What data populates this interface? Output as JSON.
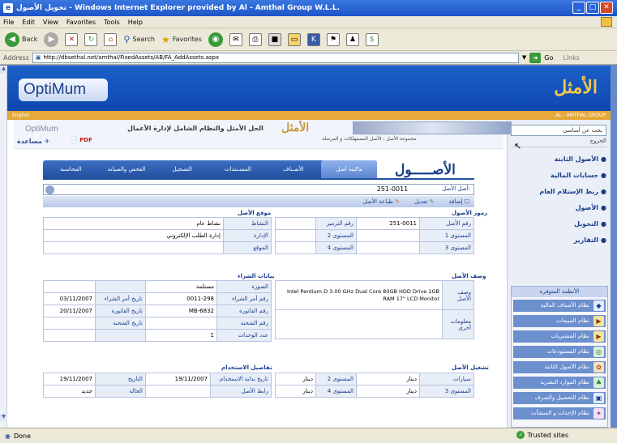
{
  "window": {
    "title": "تحويل الأصول - Windows Internet Explorer provided by Al - Amthal Group W.L.L."
  },
  "menu": [
    "File",
    "Edit",
    "View",
    "Favorites",
    "Tools",
    "Help"
  ],
  "toolbar": {
    "back": "Back",
    "search": "Search",
    "favorites": "Favorites"
  },
  "address": {
    "label": "Address",
    "url": "http://dbsethal.net/amthal/FixedAssets/AB/FA_AddAssets.aspx",
    "go": "Go",
    "links": "Links"
  },
  "banner": {
    "logo": "OptiMum",
    "logo_ar": "الأمثل",
    "english": "English",
    "company": "AL - AMTHAL GROUP"
  },
  "header": {
    "logo": "OptiMum",
    "title": "الحل الأمثل والنظام الشامل لإدارة الأعمال",
    "logo_ar": "الأمثل",
    "breadcrumb": "مجموعة الأصل : الأصل المستهلكات و المرسلة",
    "help": "مساعدة",
    "pdf": "PDF"
  },
  "rightnav": {
    "search": "بحث عن أساسي",
    "header": "الخروج",
    "items": [
      "الأصول الثابتة",
      "حسابات المالية",
      "ربط الإستلام العام",
      "الأصول",
      "التحويل",
      "التقارير"
    ],
    "systems_title": "الأنظمة المتوفرة",
    "systems": [
      "نظام الأصناف المالية",
      "نظام المبيعات",
      "نظام المشتريات",
      "نظام المستودعات",
      "نظام الأصول الثابتة",
      "نظام الموارد البشرية",
      "نظام التحصيل والصرف",
      "نظام الإحداث و المنشآت"
    ]
  },
  "section": {
    "title": "الأصـــــول"
  },
  "tabs": [
    "ماكينة أصل",
    "الأصـناف",
    "المسـتندات",
    "التسجيل",
    "الفحص والصيانة",
    "المحاسبة"
  ],
  "asset": {
    "label": "أصل الأصل:",
    "value": "251-0011"
  },
  "actions": [
    "إضافة",
    "تعديل",
    "طباعة الأصل"
  ],
  "codes": {
    "head": "رموز الأصول",
    "rows": [
      [
        "رقم الأصل",
        "251-0011",
        "رقم الترميز",
        ""
      ],
      [
        "المستوى 1",
        "",
        "المستوى 2",
        ""
      ],
      [
        "المستوى 3",
        "",
        "المستوى 4",
        ""
      ]
    ]
  },
  "location": {
    "head": "موقع الأصل",
    "rows": [
      [
        "النشاط",
        "نشاط عام"
      ],
      [
        "الإدارة",
        "إدارة الطلب الإلكتروني"
      ],
      [
        "الموقع",
        ""
      ]
    ]
  },
  "description": {
    "head": "وصف الأصل",
    "label": "وصف الأصل",
    "text": "Intel Pentium D 3.00 GHz Dual Core 80GB HDD Drive 1GB RAM 17\" LCD Monitor",
    "extra_label": "معلومات أخرى"
  },
  "invoice": {
    "head": "بيانات الشراء",
    "rows": [
      [
        "الصورة",
        "مستلمة",
        "",
        ""
      ],
      [
        "رقم أمر الشراء",
        "0011-298",
        "تاريخ أمر الشراء",
        "03/11/2007"
      ],
      [
        "رقم الفاتورة",
        "MB-6832",
        "تاريخ الفاتورة",
        "20/11/2007"
      ],
      [
        "رقم الشحنة",
        "",
        "تاريخ الشحنة",
        ""
      ],
      [
        "عدد الوحدات",
        "1",
        "",
        ""
      ]
    ]
  },
  "depreciation": {
    "head": "تشغيل الأصل",
    "rows": [
      [
        "سيارات",
        "دينار",
        "المستوى 2",
        "دينار"
      ],
      [
        "المستوى 3",
        "دينار",
        "المستوى 4",
        "دينار"
      ]
    ]
  },
  "start": {
    "head": "تفاصيل الاستخدام",
    "rows": [
      [
        "تاريخ بداية الاستخدام",
        "19/11/2007",
        "التاريخ",
        "19/11/2007"
      ],
      [
        "رابط الأصل",
        "",
        "الحالة",
        "جديد"
      ]
    ]
  },
  "status": {
    "done": "Done",
    "zone": "Trusted sites"
  }
}
